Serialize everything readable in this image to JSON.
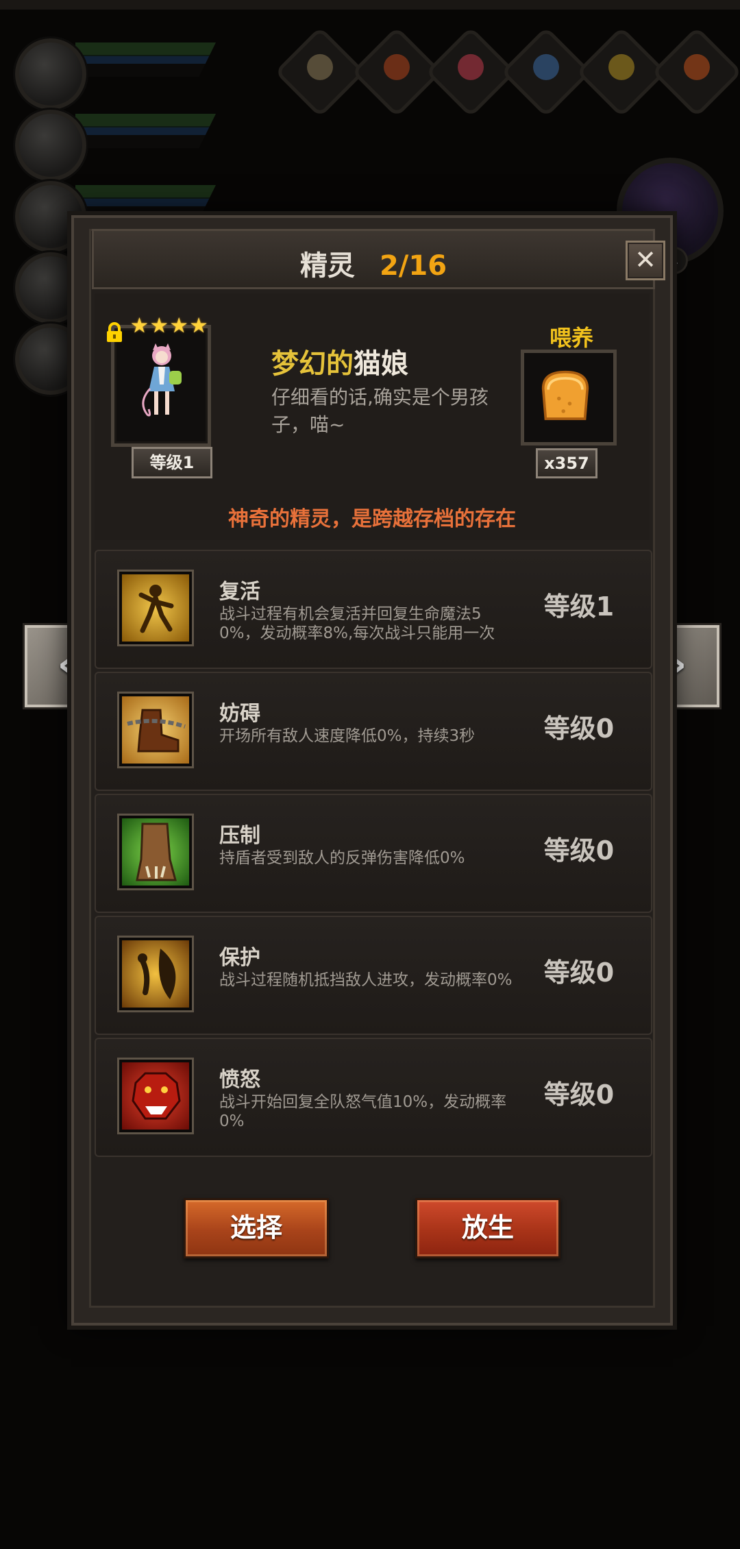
{
  "dialog": {
    "title": "精灵",
    "count": "2/16",
    "close_label": "✕"
  },
  "spirit": {
    "stars": "★★★★",
    "level": "等级1",
    "name_adj": "梦幻的",
    "name_noun": "猫娘",
    "description": "仔细看的话,确实是个男孩子，喵~",
    "feed_label": "喂养",
    "feed_count": "x357",
    "note": "神奇的精灵，是跨越存档的存在"
  },
  "skills": [
    {
      "name": "复活",
      "desc": "战斗过程有机会复活并回复生命魔法50%，发动概率8%,每次战斗只能用一次",
      "level": "等级1",
      "icon": "revive-icon"
    },
    {
      "name": "妨碍",
      "desc": "开场所有敌人速度降低0%，持续3秒",
      "level": "等级0",
      "icon": "chained-boot-icon"
    },
    {
      "name": "压制",
      "desc": "持盾者受到敌人的反弹伤害降低0%",
      "level": "等级0",
      "icon": "claw-icon"
    },
    {
      "name": "保护",
      "desc": "战斗过程随机抵挡敌人进攻，发动概率0%",
      "level": "等级0",
      "icon": "shield-fairy-icon"
    },
    {
      "name": "愤怒",
      "desc": "战斗开始回复全队怒气值10%，发动概率0%",
      "level": "等级0",
      "icon": "panther-icon"
    }
  ],
  "buttons": {
    "select": "选择",
    "release": "放生"
  },
  "nav": {
    "prev": "‹",
    "next": "›"
  },
  "background": {
    "badge": "1"
  }
}
